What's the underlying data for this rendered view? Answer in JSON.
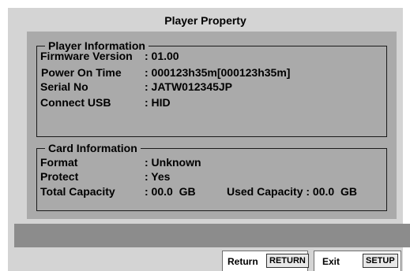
{
  "title": "Player Property",
  "player_information": {
    "legend": "Player Information",
    "rows": [
      {
        "label": "Firmware Version",
        "value": ": 01.00"
      },
      {
        "label": "Power On Time",
        "value": ": 000123h35m[000123h35m]"
      },
      {
        "label": "Serial No",
        "value": ": JATW012345JP"
      },
      {
        "label": "Connect USB",
        "value": ": HID"
      }
    ]
  },
  "card_information": {
    "legend": "Card Information",
    "rows": [
      {
        "label": "Format",
        "value": ": Unknown"
      },
      {
        "label": "Protect",
        "value": ": Yes"
      },
      {
        "label": "Total Capacity",
        "value": ": 00.0  GB"
      }
    ],
    "used_capacity": "Used Capacity : 00.0  GB"
  },
  "buttons": {
    "return_label": "Return",
    "return_key": "RETURN",
    "exit_label": "Exit",
    "exit_key": "SETUP"
  },
  "colors": {
    "screen_bg": "#d4d4d4",
    "panel_bg": "#aaaaaa",
    "status_bar": "#8c8c8c"
  }
}
